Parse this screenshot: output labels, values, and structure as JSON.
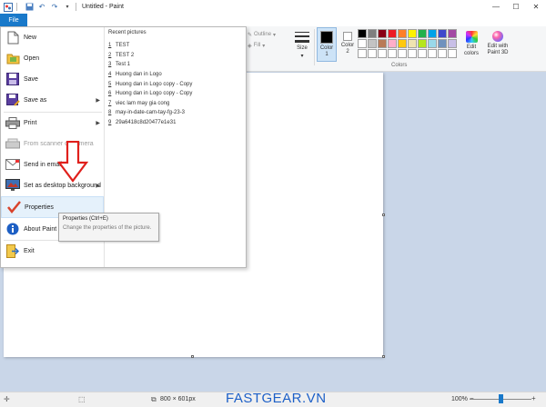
{
  "window": {
    "title": "Untitled - Paint",
    "controls": {
      "minimize": "—",
      "maximize": "☐",
      "close": "✕"
    }
  },
  "ribbon": {
    "file_tab": "File",
    "outline_label": "Outline",
    "fill_label": "Fill",
    "size_label": "Size",
    "color1_label": "Color\n1",
    "color2_label": "Color\n2",
    "colors_caption": "Colors",
    "edit_colors_label": "Edit\ncolors",
    "paint3d_label": "Edit with\nPaint 3D",
    "color1_value": "#000000",
    "color2_value": "#ffffff",
    "palette": [
      "#000000",
      "#7f7f7f",
      "#880015",
      "#ed1c24",
      "#ff7f27",
      "#fff200",
      "#22b14c",
      "#00a2e8",
      "#3f48cc",
      "#a349a4",
      "#ffffff",
      "#c3c3c3",
      "#b97a57",
      "#ffaec9",
      "#ffc90e",
      "#efe4b0",
      "#b5e61d",
      "#99d9ea",
      "#7092be",
      "#c8bfe7",
      "#ffffff",
      "#ffffff",
      "#ffffff",
      "#ffffff",
      "#ffffff",
      "#ffffff",
      "#ffffff",
      "#ffffff",
      "#ffffff",
      "#ffffff"
    ]
  },
  "file_menu": {
    "items": [
      {
        "label": "New",
        "icon": "new-file-icon"
      },
      {
        "label": "Open",
        "icon": "open-folder-icon"
      },
      {
        "label": "Save",
        "icon": "save-icon"
      },
      {
        "label": "Save as",
        "icon": "save-as-icon"
      },
      {
        "label": "Print",
        "icon": "printer-icon"
      },
      {
        "label": "From scanner or camera",
        "icon": "scanner-icon"
      },
      {
        "label": "Send in email",
        "icon": "email-icon"
      },
      {
        "label": "Set as desktop background",
        "icon": "desktop-background-icon"
      },
      {
        "label": "Properties",
        "icon": "checkmark-icon"
      },
      {
        "label": "About Paint",
        "icon": "info-icon"
      },
      {
        "label": "Exit",
        "icon": "exit-icon"
      }
    ],
    "recent_title": "Recent pictures",
    "recent": [
      {
        "num": "1",
        "name": "TEST"
      },
      {
        "num": "2",
        "name": "TEST 2"
      },
      {
        "num": "3",
        "name": "Test 1"
      },
      {
        "num": "4",
        "name": "Huong dan in Logo"
      },
      {
        "num": "5",
        "name": "Huong dan in Logo copy - Copy"
      },
      {
        "num": "6",
        "name": "Huong dan in Logo copy - Copy"
      },
      {
        "num": "7",
        "name": "viec lam may gia cong"
      },
      {
        "num": "8",
        "name": "may-in-date-cam-tay-fg-23-3"
      },
      {
        "num": "9",
        "name": "29a6418c8d20477e1e31"
      }
    ]
  },
  "tooltip": {
    "title": "Properties (Ctrl+E)",
    "body": "Change the properties of the picture."
  },
  "status": {
    "dimensions": "800 × 601px",
    "zoom": "100%",
    "zoom_level": 0.5
  },
  "watermark": "FASTGEAR.VN"
}
